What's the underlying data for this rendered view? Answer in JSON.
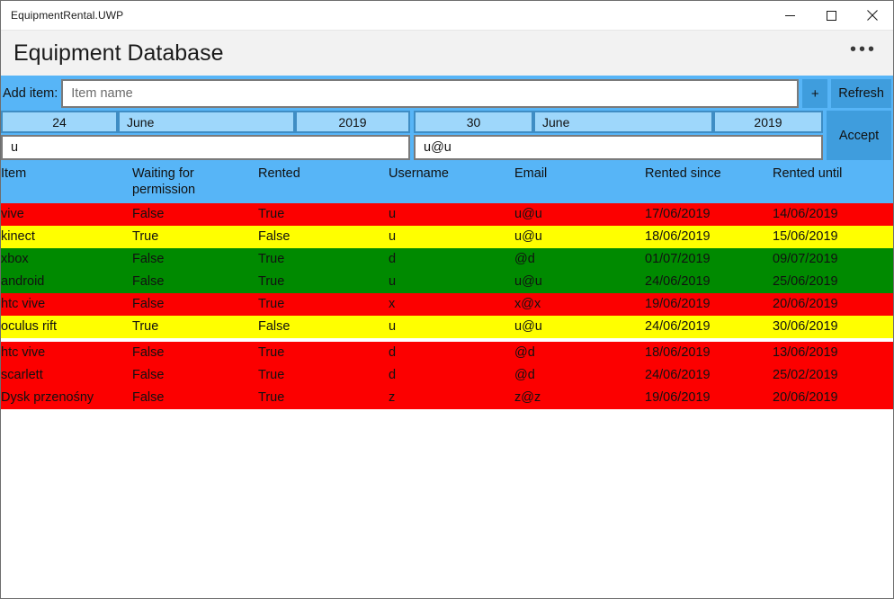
{
  "window": {
    "title": "EquipmentRental.UWP",
    "controls": {
      "minimize": "minimize-icon",
      "maximize": "maximize-icon",
      "close": "close-icon"
    }
  },
  "header": {
    "title": "Equipment Database",
    "more_label": "•••"
  },
  "toolbar": {
    "add_item_label": "Add item:",
    "item_name_value": "",
    "item_name_placeholder": "Item name",
    "add_label": "+",
    "refresh_label": "Refresh",
    "accept_label": "Accept"
  },
  "date_from": {
    "day": "24",
    "month": "June",
    "year": "2019"
  },
  "date_to": {
    "day": "30",
    "month": "June",
    "year": "2019"
  },
  "search": {
    "username_value": "u",
    "username_placeholder": "",
    "email_value": "u@u",
    "email_placeholder": ""
  },
  "table": {
    "columns": [
      "Item",
      "Waiting for permission",
      "Rented",
      "Username",
      "Email",
      "Rented since",
      "Rented until"
    ],
    "rows": [
      {
        "item": "vive",
        "waiting": "False",
        "rented": "True",
        "username": "u",
        "email": "u@u",
        "since": "17/06/2019",
        "until": "14/06/2019",
        "status": "red"
      },
      {
        "item": "kinect",
        "waiting": "True",
        "rented": "False",
        "username": "u",
        "email": "u@u",
        "since": "18/06/2019",
        "until": "15/06/2019",
        "status": "yellow"
      },
      {
        "item": "xbox",
        "waiting": "False",
        "rented": "True",
        "username": "d",
        "email": "@d",
        "since": "01/07/2019",
        "until": "09/07/2019",
        "status": "green"
      },
      {
        "item": "android",
        "waiting": "False",
        "rented": "True",
        "username": "u",
        "email": "u@u",
        "since": "24/06/2019",
        "until": "25/06/2019",
        "status": "green"
      },
      {
        "item": "htc vive",
        "waiting": "False",
        "rented": "True",
        "username": "x",
        "email": "x@x",
        "since": "19/06/2019",
        "until": "20/06/2019",
        "status": "red"
      },
      {
        "item": "oculus rift",
        "waiting": "True",
        "rented": "False",
        "username": "u",
        "email": "u@u",
        "since": "24/06/2019",
        "until": "30/06/2019",
        "status": "yellow"
      },
      {
        "item": "htc vive",
        "waiting": "False",
        "rented": "True",
        "username": "d",
        "email": "@d",
        "since": "18/06/2019",
        "until": "13/06/2019",
        "status": "red"
      },
      {
        "item": "scarlett",
        "waiting": "False",
        "rented": "True",
        "username": "d",
        "email": "@d",
        "since": "24/06/2019",
        "until": "25/02/2019",
        "status": "red"
      },
      {
        "item": "Dysk przenośny",
        "waiting": "False",
        "rented": "True",
        "username": "z",
        "email": "z@z",
        "since": "19/06/2019",
        "until": "20/06/2019",
        "status": "red"
      }
    ],
    "spacer_after_index": 5
  },
  "colors": {
    "accent_blue": "#57b5f7",
    "button_blue": "#3f9ddd",
    "date_field_blue": "#9ed7fb",
    "status_red": "#fc0000",
    "status_yellow": "#ffff00",
    "status_green": "#008a00",
    "header_bar": "#f2f2f2"
  }
}
